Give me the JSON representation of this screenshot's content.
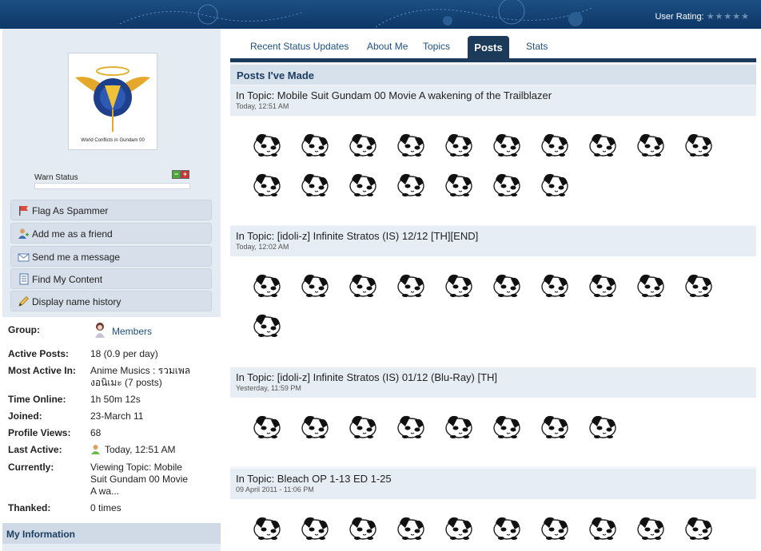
{
  "header": {
    "user_rating_label": "User Rating:",
    "stars": "★★★★★"
  },
  "sidebar": {
    "avatar_caption": "World Conflicts in Gundam 00",
    "warn_status_label": "Warn Status",
    "warn_minus": "−",
    "warn_plus": "+",
    "actions": [
      {
        "label": "Flag As Spammer",
        "icon": "flag-icon"
      },
      {
        "label": "Add me as a friend",
        "icon": "add-friend-icon"
      },
      {
        "label": "Send me a message",
        "icon": "envelope-icon"
      },
      {
        "label": "Find My Content",
        "icon": "document-icon"
      },
      {
        "label": "Display name history",
        "icon": "pencil-icon"
      }
    ],
    "info": [
      {
        "key": "Group:",
        "value": "Members"
      },
      {
        "key": "Active Posts:",
        "value": "18 (0.9 per day)"
      },
      {
        "key": "Most Active In:",
        "value": "Anime Musics : รวมเพลงอนิเมะ (7 posts)"
      },
      {
        "key": "Time Online:",
        "value": "1h 50m 12s"
      },
      {
        "key": "Joined:",
        "value": "23-March 11"
      },
      {
        "key": "Profile Views:",
        "value": "68"
      },
      {
        "key": "Last Active:",
        "value": "Today, 12:51 AM"
      },
      {
        "key": "Currently:",
        "value": "Viewing Topic: Mobile Suit Gundam 00 Movie A wa..."
      },
      {
        "key": "Thanked:",
        "value": "0 times"
      }
    ],
    "my_information": "My Information"
  },
  "tabs": [
    {
      "label": "Recent Status Updates",
      "active": false
    },
    {
      "label": "About Me",
      "active": false
    },
    {
      "label": "Topics",
      "active": false
    },
    {
      "label": "Posts",
      "active": true
    },
    {
      "label": "Stats",
      "active": false
    }
  ],
  "main": {
    "title": "Posts I've Made",
    "posts": [
      {
        "topic": "In Topic: Mobile Suit Gundam 00 Movie A wakening of the Trailblazer",
        "date": "Today, 12:51 AM",
        "emotes": 17
      },
      {
        "topic": "In Topic: [idoli-z] Infinite Stratos (IS) 12/12 [TH][END]",
        "date": "Today, 12:02 AM",
        "emotes": 11
      },
      {
        "topic": "In Topic: [idoli-z] Infinite Stratos (IS) 01/12 (Blu-Ray) [TH]",
        "date": "Yesterday, 11:59 PM",
        "emotes": 8
      },
      {
        "topic": "In Topic: Bleach OP 1-13 ED 1-25",
        "date": "09 April 2011 - 11:06 PM",
        "emotes": 10
      }
    ]
  },
  "colors": {
    "header": "#0d3766",
    "tab_active": "#1c3b5a",
    "sidebar_bg": "#e5ebf3",
    "link": "#1d4f82"
  }
}
